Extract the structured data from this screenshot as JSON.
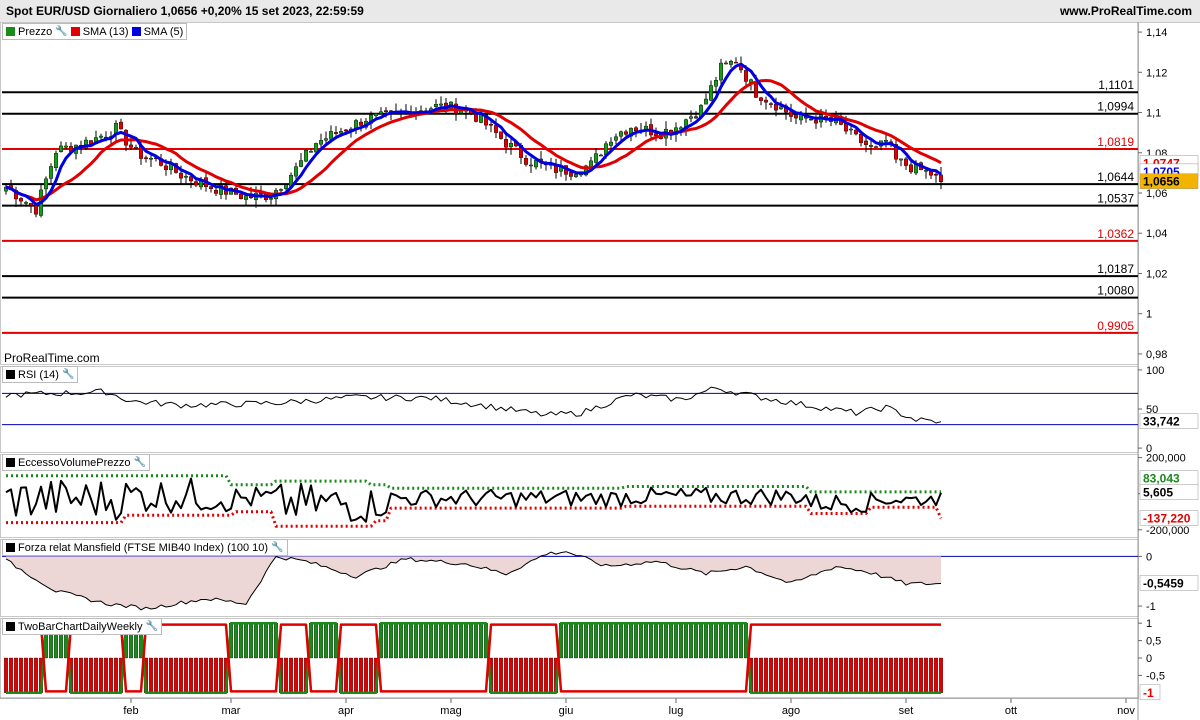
{
  "header": {
    "title": "Spot EUR/USD Giornaliero 1,0656 +0,20% 15 set 2023, 22:59:59",
    "site": "www.ProRealTime.com"
  },
  "price_panel": {
    "watermark": "ProRealTime.com",
    "legend": [
      {
        "label": "Prezzo",
        "color": "#1a8a1a"
      },
      {
        "label": "SMA (13)",
        "color": "#e00000"
      },
      {
        "label": "SMA (5)",
        "color": "#0000e0"
      }
    ],
    "current_price_label": "1,0656",
    "sma13_label": "1,0747",
    "sma5_label": "1,0705",
    "levels": [
      {
        "value": 1.1101,
        "label": "1,1101",
        "color": "#000000"
      },
      {
        "value": 1.0994,
        "label": "1,0994",
        "color": "#000000"
      },
      {
        "value": 1.0819,
        "label": "1,0819",
        "color": "#e00000"
      },
      {
        "value": 1.0644,
        "label": "1,0644",
        "color": "#000000"
      },
      {
        "value": 1.0537,
        "label": "1,0537",
        "color": "#000000"
      },
      {
        "value": 1.0362,
        "label": "1,0362",
        "color": "#e00000"
      },
      {
        "value": 1.0187,
        "label": "1,0187",
        "color": "#000000"
      },
      {
        "value": 1.008,
        "label": "1,0080",
        "color": "#000000"
      },
      {
        "value": 0.9905,
        "label": "0,9905",
        "color": "#e00000"
      }
    ],
    "yticks": [
      {
        "v": 1.14,
        "l": "1,14"
      },
      {
        "v": 1.12,
        "l": "1,12"
      },
      {
        "v": 1.1,
        "l": "1,1"
      },
      {
        "v": 1.08,
        "l": "1,08"
      },
      {
        "v": 1.06,
        "l": "1,06"
      },
      {
        "v": 1.04,
        "l": "1,04"
      },
      {
        "v": 1.02,
        "l": "1,02"
      },
      {
        "v": 1.0,
        "l": "1"
      },
      {
        "v": 0.98,
        "l": "0,98"
      }
    ]
  },
  "rsi_panel": {
    "label": "RSI (14)",
    "value_label": "33,742",
    "yticks": [
      {
        "v": 100,
        "l": "100"
      },
      {
        "v": 50,
        "l": "50"
      },
      {
        "v": 0,
        "l": "0"
      }
    ]
  },
  "evp_panel": {
    "label": "EccessoVolumePrezzo",
    "upper_label": "83,043",
    "line_label": "5,605",
    "lower_label": "-137,220",
    "yticks": [
      {
        "v": 200,
        "l": "200,000"
      },
      {
        "v": 0,
        "l": "0"
      },
      {
        "v": -200,
        "l": "-200,000"
      }
    ]
  },
  "mansfield_panel": {
    "label": "Forza relat Mansfield (FTSE MIB40 Index) (100 10)",
    "value_label": "-0,5459",
    "yticks": [
      {
        "v": 0,
        "l": "0"
      },
      {
        "v": -1,
        "l": "-1"
      }
    ]
  },
  "twobar_panel": {
    "label": "TwoBarChartDailyWeekly",
    "value_label": "-1",
    "yticks": [
      {
        "v": 1,
        "l": "1"
      },
      {
        "v": 0.5,
        "l": "0,5"
      },
      {
        "v": 0,
        "l": "0"
      },
      {
        "v": -0.5,
        "l": "-0,5"
      }
    ]
  },
  "x_axis": {
    "months": [
      {
        "label": "feb",
        "bar": 25
      },
      {
        "label": "mar",
        "bar": 45
      },
      {
        "label": "apr",
        "bar": 68
      },
      {
        "label": "mag",
        "bar": 89
      },
      {
        "label": "giu",
        "bar": 112
      },
      {
        "label": "lug",
        "bar": 134
      },
      {
        "label": "ago",
        "bar": 157
      },
      {
        "label": "set",
        "bar": 180
      },
      {
        "label": "ott",
        "bar": 201
      },
      {
        "label": "nov",
        "bar": 224
      }
    ]
  },
  "chart_data": {
    "type": "line",
    "x_unit": "trading day index",
    "anchors": {
      "close": [
        [
          0,
          1.063
        ],
        [
          6,
          1.052
        ],
        [
          10,
          1.081
        ],
        [
          17,
          1.086
        ],
        [
          22,
          1.092
        ],
        [
          26,
          1.08
        ],
        [
          31,
          1.075
        ],
        [
          35,
          1.069
        ],
        [
          41,
          1.063
        ],
        [
          48,
          1.058
        ],
        [
          53,
          1.059
        ],
        [
          58,
          1.072
        ],
        [
          62,
          1.085
        ],
        [
          67,
          1.091
        ],
        [
          72,
          1.097
        ],
        [
          77,
          1.098
        ],
        [
          81,
          1.101
        ],
        [
          86,
          1.103
        ],
        [
          92,
          1.102
        ],
        [
          96,
          1.094
        ],
        [
          100,
          1.085
        ],
        [
          104,
          1.077
        ],
        [
          109,
          1.072
        ],
        [
          113,
          1.071
        ],
        [
          117,
          1.074
        ],
        [
          121,
          1.088
        ],
        [
          125,
          1.093
        ],
        [
          131,
          1.09
        ],
        [
          134,
          1.093
        ],
        [
          139,
          1.102
        ],
        [
          143,
          1.122
        ],
        [
          146,
          1.126
        ],
        [
          150,
          1.11
        ],
        [
          154,
          1.104
        ],
        [
          158,
          1.097
        ],
        [
          162,
          1.097
        ],
        [
          166,
          1.095
        ],
        [
          170,
          1.087
        ],
        [
          174,
          1.081
        ],
        [
          176,
          1.086
        ],
        [
          178,
          1.076
        ],
        [
          182,
          1.072
        ],
        [
          185,
          1.0695
        ],
        [
          187,
          1.0656
        ]
      ],
      "rsi": [
        [
          0,
          68
        ],
        [
          10,
          70
        ],
        [
          20,
          72
        ],
        [
          25,
          60
        ],
        [
          35,
          55
        ],
        [
          45,
          56
        ],
        [
          55,
          58
        ],
        [
          70,
          65
        ],
        [
          85,
          64
        ],
        [
          95,
          55
        ],
        [
          108,
          42
        ],
        [
          115,
          45
        ],
        [
          125,
          68
        ],
        [
          135,
          62
        ],
        [
          142,
          77
        ],
        [
          150,
          66
        ],
        [
          160,
          55
        ],
        [
          170,
          45
        ],
        [
          176,
          52
        ],
        [
          182,
          36
        ],
        [
          187,
          33.7
        ]
      ],
      "evp_upper": [
        [
          0,
          100
        ],
        [
          44,
          100
        ],
        [
          45,
          50
        ],
        [
          53,
          50
        ],
        [
          54,
          70
        ],
        [
          72,
          70
        ],
        [
          73,
          50
        ],
        [
          76,
          50
        ],
        [
          77,
          30
        ],
        [
          123,
          30
        ],
        [
          124,
          40
        ],
        [
          160,
          40
        ],
        [
          161,
          10
        ],
        [
          187,
          10
        ]
      ],
      "evp_lower": [
        [
          0,
          -160
        ],
        [
          23,
          -160
        ],
        [
          24,
          -120
        ],
        [
          45,
          -120
        ],
        [
          46,
          -100
        ],
        [
          53,
          -100
        ],
        [
          54,
          -180
        ],
        [
          73,
          -180
        ],
        [
          74,
          -150
        ],
        [
          76,
          -150
        ],
        [
          77,
          -80
        ],
        [
          123,
          -80
        ],
        [
          124,
          -70
        ],
        [
          160,
          -70
        ],
        [
          161,
          -110
        ],
        [
          172,
          -110
        ],
        [
          173,
          -75
        ],
        [
          186,
          -75
        ],
        [
          187,
          -137
        ]
      ],
      "mansfield": [
        [
          0,
          -0.08
        ],
        [
          10,
          -0.7
        ],
        [
          20,
          -0.95
        ],
        [
          28,
          -1.05
        ],
        [
          40,
          -0.85
        ],
        [
          48,
          -0.95
        ],
        [
          54,
          0.0
        ],
        [
          60,
          -0.1
        ],
        [
          70,
          -0.4
        ],
        [
          80,
          -0.05
        ],
        [
          92,
          -0.15
        ],
        [
          100,
          -0.35
        ],
        [
          108,
          0.05
        ],
        [
          112,
          0.1
        ],
        [
          120,
          -0.2
        ],
        [
          130,
          -0.1
        ],
        [
          140,
          -0.35
        ],
        [
          148,
          -0.2
        ],
        [
          157,
          -0.55
        ],
        [
          166,
          -0.2
        ],
        [
          172,
          -0.3
        ],
        [
          180,
          -0.55
        ],
        [
          187,
          -0.55
        ]
      ]
    },
    "twobar_states": [
      [
        0,
        7,
        -1
      ],
      [
        8,
        12,
        1
      ],
      [
        13,
        23,
        -1
      ],
      [
        24,
        27,
        1
      ],
      [
        28,
        44,
        -1
      ],
      [
        45,
        54,
        1
      ],
      [
        55,
        60,
        -1
      ],
      [
        61,
        66,
        1
      ],
      [
        67,
        74,
        -1
      ],
      [
        75,
        96,
        1
      ],
      [
        97,
        110,
        -1
      ],
      [
        111,
        119,
        1
      ],
      [
        120,
        148,
        1
      ],
      [
        149,
        171,
        -1
      ],
      [
        172,
        187,
        -1
      ]
    ]
  }
}
